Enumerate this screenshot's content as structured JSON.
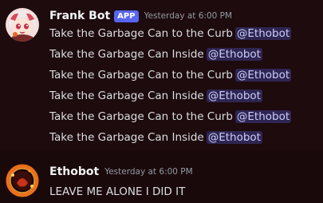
{
  "messages": [
    {
      "username": "Frank Bot",
      "badge": "APP",
      "timestamp": "Yesterday at 6:00 PM",
      "lines": [
        {
          "text": "Take the Garbage Can to the Curb",
          "mention": "@Ethobot"
        },
        {
          "text": "Take the Garbage Can Inside",
          "mention": "@Ethobot"
        },
        {
          "text": "Take the Garbage Can to the Curb",
          "mention": "@Ethobot"
        },
        {
          "text": "Take the Garbage Can Inside",
          "mention": "@Ethobot"
        },
        {
          "text": "Take the Garbage Can to the Curb",
          "mention": "@Ethobot"
        },
        {
          "text": "Take the Garbage Can Inside",
          "mention": "@Ethobot"
        }
      ]
    },
    {
      "username": "Ethobot",
      "timestamp": "Yesterday at 6:00 PM",
      "lines": [
        {
          "text": "LEAVE ME ALONE I DID IT"
        }
      ]
    }
  ],
  "colors": {
    "background": "#1b0a0c",
    "badge": "#5865f2",
    "mention_bg": "#3a3675",
    "mention_text": "#c9cdfb",
    "timestamp": "#949ba4"
  },
  "icons": {
    "frank_bot_avatar": "anime-character-avatar",
    "ethobot_avatar": "fire-ring-avatar"
  }
}
